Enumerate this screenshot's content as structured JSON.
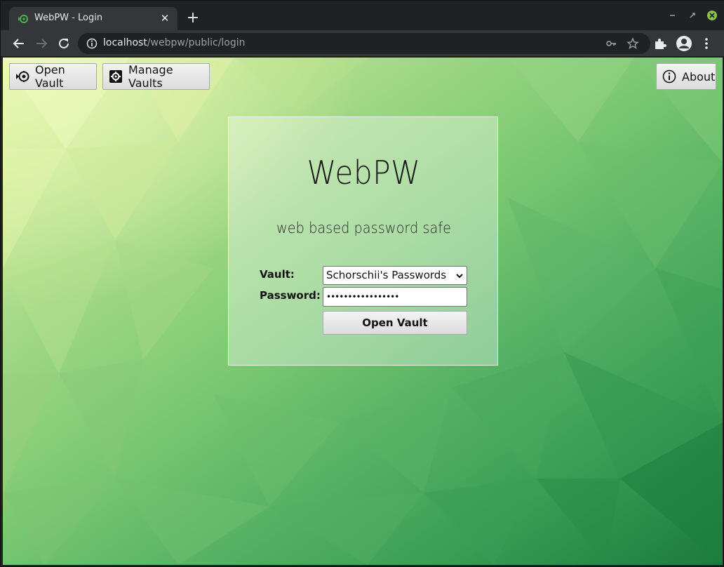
{
  "browser": {
    "tab_title": "WebPW - Login",
    "url_host": "localhost",
    "url_path": "/webpw/public/login",
    "icons": [
      "webpw-favicon",
      "close-icon",
      "plus-icon",
      "minimize-icon",
      "maximize-icon",
      "close-window-icon",
      "back-icon",
      "forward-icon",
      "reload-icon",
      "info-icon",
      "key-icon",
      "star-icon",
      "extensions-icon",
      "profile-icon",
      "menu-icon"
    ]
  },
  "topbar": {
    "open_vault_label": "Open Vault",
    "manage_vaults_label": "Manage Vaults",
    "about_label": "About"
  },
  "login": {
    "title": "WebPW",
    "tagline": "web based password safe",
    "vault_label": "Vault:",
    "vault_selected": "Schorschii's Passwords",
    "password_label": "Password:",
    "password_masked": "•••••••••••••••••",
    "submit_label": "Open Vault"
  },
  "colors": {
    "chrome_dark": "#202124",
    "chrome_toolbar": "#35363a",
    "bg_light": "#d8efa0",
    "bg_dark": "#1c7a3e"
  }
}
